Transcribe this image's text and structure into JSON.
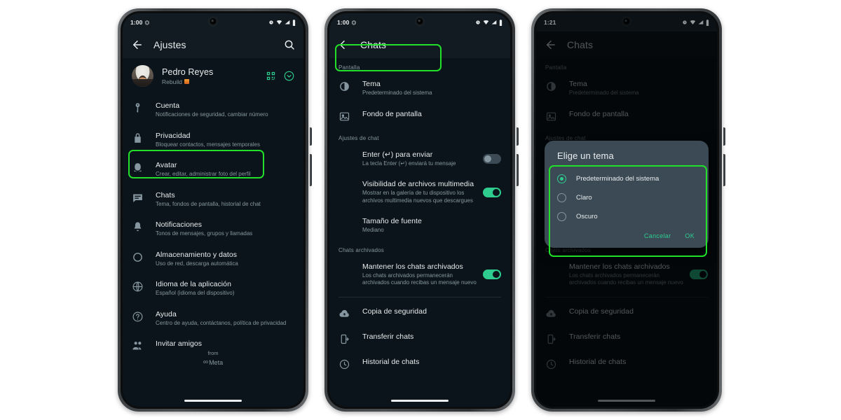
{
  "phone1": {
    "status_bar": {
      "time": "1:00",
      "left_icon": "mute-icon",
      "right_icons": [
        "alarm-icon",
        "wifi-icon",
        "signal-icon",
        "battery-icon"
      ]
    },
    "app_bar": {
      "title": "Ajustes",
      "back": "back-arrow-icon",
      "search": "search-icon"
    },
    "profile": {
      "name": "Pedro Reyes",
      "status": "Rebuild",
      "qr_label": "qr-code-icon",
      "chevron_label": "chevron-down-icon"
    },
    "items": [
      {
        "icon": "key-icon",
        "title": "Cuenta",
        "subtitle": "Notificaciones de seguridad, cambiar número"
      },
      {
        "icon": "lock-icon",
        "title": "Privacidad",
        "subtitle": "Bloquear contactos, mensajes temporales"
      },
      {
        "icon": "avatar-icon",
        "title": "Avatar",
        "subtitle": "Crear, editar, administrar foto del perfil"
      },
      {
        "icon": "chat-icon",
        "title": "Chats",
        "subtitle": "Tema, fondos de pantalla, historial de chat"
      },
      {
        "icon": "bell-icon",
        "title": "Notificaciones",
        "subtitle": "Tonos de mensajes, grupos y llamadas"
      },
      {
        "icon": "storage-icon",
        "title": "Almacenamiento y datos",
        "subtitle": "Uso de red, descarga automática"
      },
      {
        "icon": "globe-icon",
        "title": "Idioma de la aplicación",
        "subtitle": "Español (idioma del dispositivo)"
      },
      {
        "icon": "help-icon",
        "title": "Ayuda",
        "subtitle": "Centro de ayuda, contáctanos, política de privacidad"
      },
      {
        "icon": "invite-icon",
        "title": "Invitar amigos",
        "subtitle": ""
      }
    ],
    "footer": {
      "from": "from",
      "brand": "Meta"
    },
    "highlight": "chats-row"
  },
  "phone2": {
    "status_bar": {
      "time": "1:00"
    },
    "app_bar": {
      "title": "Chats"
    },
    "section_display": "Pantalla",
    "section_chat": "Ajustes de chat",
    "section_archived": "Chats archivados",
    "theme": {
      "icon": "theme-contrast-icon",
      "title": "Tema",
      "value": "Predeterminado del sistema"
    },
    "wallpaper": {
      "icon": "wallpaper-icon",
      "title": "Fondo de pantalla"
    },
    "enter_send": {
      "title": "Enter (↵) para enviar",
      "subtitle": "La tecla Enter (↵) enviará tu mensaje",
      "toggle": "off"
    },
    "media_visibility": {
      "title": "Visibilidad de archivos multimedia",
      "subtitle": "Mostrar en la galería de tu dispositivo los archivos multimedia nuevos que descargues",
      "toggle": "on"
    },
    "font_size": {
      "title": "Tamaño de fuente",
      "value": "Mediano"
    },
    "keep_archived": {
      "title": "Mantener los chats archivados",
      "subtitle": "Los chats archivados permanecerán archivados cuando recibas un mensaje nuevo",
      "toggle": "on"
    },
    "bottom_items": [
      {
        "icon": "backup-cloud-icon",
        "title": "Copia de seguridad"
      },
      {
        "icon": "transfer-icon",
        "title": "Transferir chats"
      },
      {
        "icon": "history-clock-icon",
        "title": "Historial de chats"
      }
    ],
    "highlight": "tema-row"
  },
  "phone3": {
    "status_bar": {
      "time": "1:21"
    },
    "app_bar": {
      "title": "Chats"
    },
    "dialog": {
      "title": "Elige un tema",
      "options": [
        {
          "label": "Predeterminado del sistema",
          "selected": true
        },
        {
          "label": "Claro",
          "selected": false
        },
        {
          "label": "Oscuro",
          "selected": false
        }
      ],
      "cancel": "Cancelar",
      "ok": "OK"
    },
    "highlight": "theme-dialog-options"
  },
  "colors": {
    "highlight_green": "#22e02a",
    "accent_green": "#2ecc8f",
    "screen_bg": "#0b141a",
    "bar_bg": "#111b21",
    "primary_text": "#e9edef",
    "secondary_text": "#8696a0",
    "dialog_bg": "#3b4a54"
  }
}
